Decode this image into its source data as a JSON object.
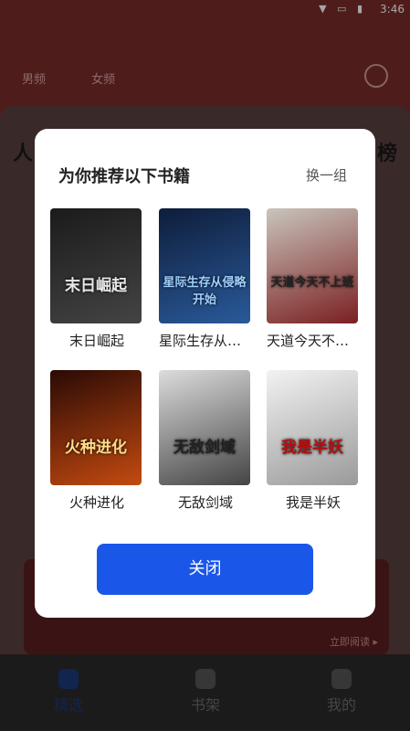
{
  "status": {
    "time": "3:46"
  },
  "background": {
    "tabs": [
      "男频",
      "女频"
    ],
    "left_heading": "人",
    "right_heading": "榜",
    "promo_action": "立即阅读 ▸"
  },
  "bottom_nav": [
    {
      "label": "精选",
      "icon": "trophy-icon"
    },
    {
      "label": "书架",
      "icon": "bookshelf-icon"
    },
    {
      "label": "我的",
      "icon": "user-icon"
    }
  ],
  "modal": {
    "title": "为你推荐以下书籍",
    "swap_label": "换一组",
    "close_label": "关闭",
    "books": [
      {
        "title": "末日崛起",
        "cover_text": "末日崛起",
        "cover_colors": [
          "#1b1b1b",
          "#444444"
        ],
        "accent": "#e8e8e8"
      },
      {
        "title": "星际生存从侵略开始",
        "cover_text": "星际生存从侵略开始",
        "cover_colors": [
          "#0e1d3a",
          "#2a5a9a"
        ],
        "accent": "#9fd0ff"
      },
      {
        "title": "天道今天不上班",
        "cover_text": "天道今天不上班",
        "cover_colors": [
          "#c9c4bd",
          "#7a2020"
        ],
        "accent": "#222222"
      },
      {
        "title": "火种进化",
        "cover_text": "火种进化",
        "cover_colors": [
          "#2a0a05",
          "#c44a10"
        ],
        "accent": "#ffdd88"
      },
      {
        "title": "无敌剑域",
        "cover_text": "无敌剑域",
        "cover_colors": [
          "#dcdcdc",
          "#444444"
        ],
        "accent": "#222222"
      },
      {
        "title": "我是半妖",
        "cover_text": "我是半妖",
        "cover_colors": [
          "#f2f2f2",
          "#9a9a9a"
        ],
        "accent": "#b01010"
      }
    ]
  }
}
